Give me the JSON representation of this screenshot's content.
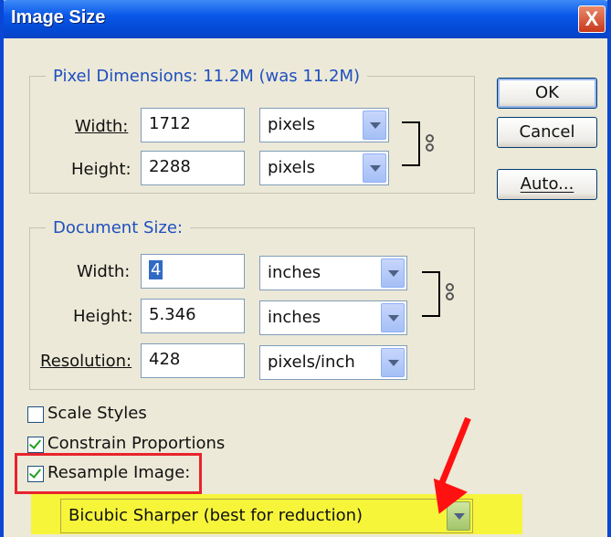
{
  "window": {
    "title": "Image Size",
    "close_label": "X"
  },
  "pixel_dimensions": {
    "legend": "Pixel Dimensions:  11.2M (was 11.2M)",
    "width_label": "Width:",
    "width_value": "1712",
    "width_unit": "pixels",
    "height_label": "Height:",
    "height_value": "2288",
    "height_unit": "pixels"
  },
  "document_size": {
    "legend": "Document Size:",
    "width_label": "Width:",
    "width_value": "4",
    "width_unit": "inches",
    "height_label": "Height:",
    "height_value": "5.346",
    "height_unit": "inches",
    "resolution_label": "Resolution:",
    "resolution_value": "428",
    "resolution_unit": "pixels/inch"
  },
  "buttons": {
    "ok": "OK",
    "cancel": "Cancel",
    "auto": "Auto..."
  },
  "options": {
    "scale_styles": {
      "label": "Scale Styles",
      "checked": false
    },
    "constrain": {
      "label": "Constrain Proportions",
      "checked": true
    },
    "resample": {
      "label": "Resample Image:",
      "checked": true
    }
  },
  "resample_method": "Bicubic Sharper (best for reduction)",
  "colors": {
    "title_bar": "#0a58e8",
    "legend": "#1f4fbf",
    "highlight_box": "#e8232d",
    "highlight_fill": "#f6f53a",
    "arrow": "#ff1111"
  },
  "icons": {
    "link": "chain-icon",
    "dropdown": "chevron-down-icon"
  }
}
